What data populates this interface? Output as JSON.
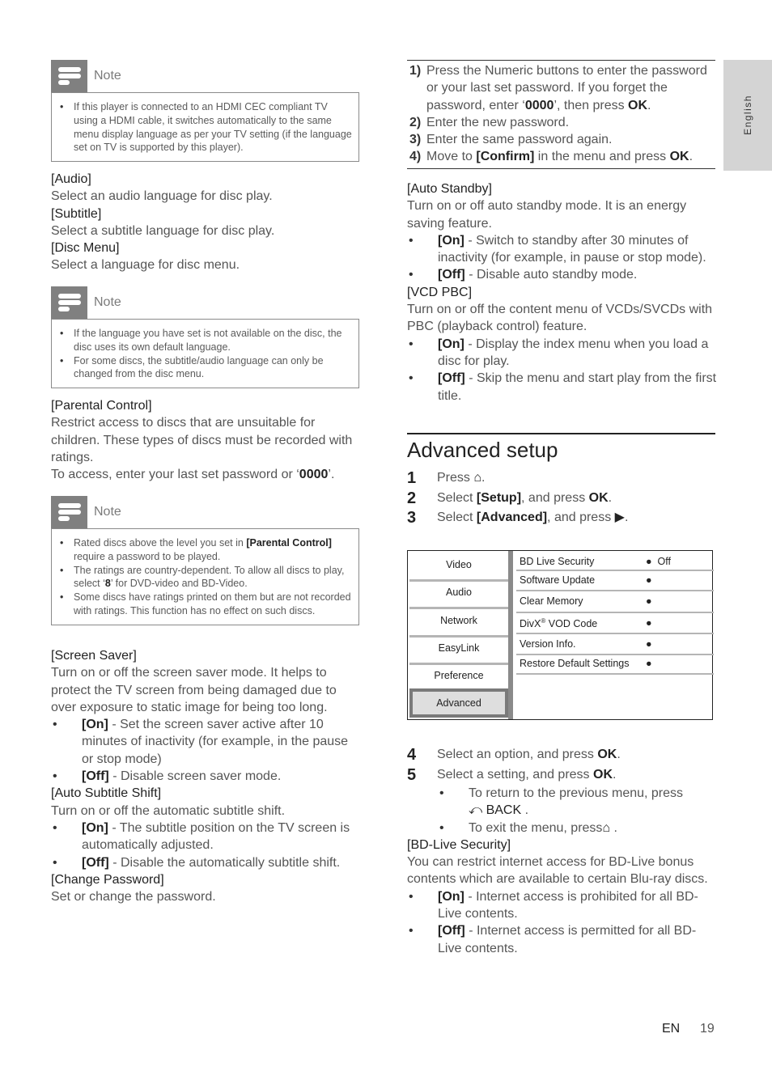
{
  "left_column": {
    "note1": {
      "label": "Note",
      "items": [
        "If this player is connected to an HDMI CEC compliant TV using a HDMI cable, it switches automatically to the same menu display language as per your TV setting (if the language set on TV is supported by this player)."
      ]
    },
    "audio": {
      "title": "[Audio]",
      "desc": "Select an audio language for disc play."
    },
    "subtitle": {
      "title": "[Subtitle]",
      "desc": "Select a subtitle language for disc play."
    },
    "disc_menu": {
      "title": "[Disc Menu]",
      "desc": "Select a language for disc menu."
    },
    "note2": {
      "label": "Note",
      "items": [
        "If the language you have set is not available on the disc, the disc uses its own default language.",
        "For some discs, the subtitle/audio language can only be changed from the disc menu."
      ]
    },
    "parental": {
      "title": "[Parental Control]",
      "desc": "Restrict access to discs that are unsuitable for children. These types of discs must be recorded with ratings.",
      "access_pre": "To access, enter your last set password or ‘",
      "access_code": "0000",
      "access_post": "’."
    },
    "note3": {
      "label": "Note",
      "item1_pre": "Rated discs above the level you set in ",
      "item1_bold": "[Parental Control]",
      "item1_post": " require a password to be played.",
      "item2_pre": "The ratings are country-dependent. To allow all discs to play, select ‘",
      "item2_bold": "8",
      "item2_post": "’ for DVD-video and BD-Video.",
      "item3": "Some discs have ratings printed on them but are not recorded with ratings. This function has no effect on such discs."
    },
    "screen_saver": {
      "title": "[Screen Saver]",
      "desc": "Turn on or off the screen saver mode. It helps to protect the TV screen from being damaged due to over exposure to static image for being too long.",
      "on_label": "[On]",
      "on_desc": " - Set the screen saver active after 10 minutes of inactivity (for example, in the pause or stop mode)",
      "off_label": "[Off]",
      "off_desc": " - Disable screen saver mode."
    },
    "auto_subtitle": {
      "title": "[Auto Subtitle Shift]",
      "desc": "Turn on or off the automatic subtitle shift.",
      "on_label": "[On]",
      "on_desc": " - The subtitle position on the TV screen is automatically adjusted.",
      "off_label": "[Off]",
      "off_desc": " - Disable the automatically subtitle shift."
    },
    "change_password": {
      "title": "[Change Password]",
      "desc": "Set or change the password."
    }
  },
  "right_column": {
    "password_steps": [
      {
        "n": "1)",
        "pre": "Press the Numeric buttons to enter the password or your last set password. If you forget the password, enter ‘",
        "b1": "0000",
        "mid": "’, then press ",
        "b2": "OK",
        "post": "."
      },
      {
        "n": "2)",
        "text": "Enter the new password."
      },
      {
        "n": "3)",
        "text": "Enter the same password again."
      },
      {
        "n": "4)",
        "pre": "Move to ",
        "b1": "[Confirm]",
        "mid": " in the menu and press ",
        "b2": "OK",
        "post": "."
      }
    ],
    "auto_standby": {
      "title": "[Auto Standby]",
      "desc": "Turn on or off auto standby mode. It is an energy saving feature.",
      "on_label": "[On]",
      "on_desc": " - Switch to standby after 30 minutes of inactivity (for example, in pause or stop mode).",
      "off_label": "[Off]",
      "off_desc": " - Disable auto standby mode."
    },
    "vcd_pbc": {
      "title": "[VCD PBC]",
      "desc": "Turn on or off the content menu of VCDs/SVCDs with PBC (playback control) feature.",
      "on_label": "[On]",
      "on_desc": " - Display the index menu when you load a disc for play.",
      "off_label": "[Off]",
      "off_desc": " - Skip the menu and start play from the first title."
    },
    "section_title": "Advanced setup",
    "steps": [
      {
        "n": "1",
        "pre": "Press ",
        "icon": "home",
        "post": "."
      },
      {
        "n": "2",
        "pre": "Select ",
        "b1": "[Setup]",
        "mid": ", and press ",
        "b2": "OK",
        "post": "."
      },
      {
        "n": "3",
        "pre": "Select ",
        "b1": "[Advanced]",
        "mid": ", and press ",
        "icon": "right-arrow",
        "post": "."
      }
    ],
    "menu": {
      "tabs": [
        "Video",
        "Audio",
        "Network",
        "EasyLink",
        "Preference",
        "Advanced"
      ],
      "active_tab": "Advanced",
      "options": [
        {
          "label": "BD Live Security",
          "value": "Off"
        },
        {
          "label": "Software Update",
          "value": ""
        },
        {
          "label": "Clear Memory",
          "value": ""
        },
        {
          "label": "DivX",
          "sup": "®",
          "label_post": " VOD Code",
          "value": ""
        },
        {
          "label": "Version Info.",
          "value": ""
        },
        {
          "label": "Restore Default Settings",
          "value": ""
        }
      ]
    },
    "steps2": [
      {
        "n": "4",
        "pre": "Select an option, and press ",
        "b": "OK",
        "post": "."
      },
      {
        "n": "5",
        "pre": "Select a setting, and press ",
        "b": "OK",
        "post": "."
      }
    ],
    "sub_bullets": {
      "return_text": "To return to the previous menu, press",
      "back_label": "BACK",
      "back_post": " .",
      "exit_text": "To exit the menu, press",
      "exit_post": " ."
    },
    "bd_live": {
      "title": "[BD-Live Security]",
      "desc": "You can restrict internet access for BD-Live bonus contents which are available to certain Blu-ray discs.",
      "on_label": "[On]",
      "on_desc": " - Internet access is prohibited for all BD-Live contents.",
      "off_label": "[Off]",
      "off_desc": " - Internet access is permitted for all BD-Live contents."
    }
  },
  "side_tab": {
    "label": "English"
  },
  "footer": {
    "lang": "EN",
    "page": "19"
  }
}
